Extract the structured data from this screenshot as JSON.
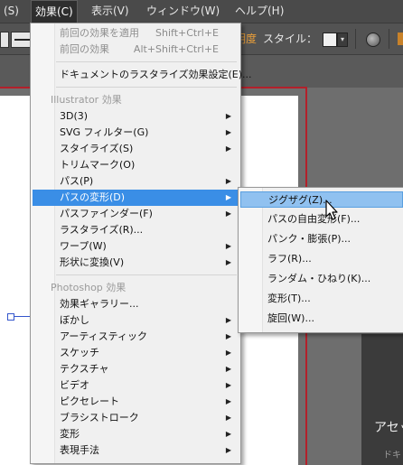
{
  "menubar": {
    "items": [
      {
        "label": "(S)",
        "active": false
      },
      {
        "label": "効果(C)",
        "active": true
      },
      {
        "label": "表示(V)",
        "active": false
      },
      {
        "label": "ウィンドウ(W)",
        "active": false
      },
      {
        "label": "ヘルプ(H)",
        "active": false
      }
    ]
  },
  "controlbar": {
    "opacity_label": "明度",
    "style_label": "スタイル："
  },
  "effect_menu": {
    "apply_last": {
      "label": "前回の効果を適用",
      "shortcut": "Shift+Ctrl+E"
    },
    "last_effect": {
      "label": "前回の効果",
      "shortcut": "Alt+Shift+Ctrl+E"
    },
    "raster_settings": "ドキュメントのラスタライズ効果設定(E)...",
    "illustrator_header": "Illustrator 効果",
    "illustrator_items": [
      {
        "label": "3D(3)",
        "submenu": true
      },
      {
        "label": "SVG フィルター(G)",
        "submenu": true
      },
      {
        "label": "スタイライズ(S)",
        "submenu": true
      },
      {
        "label": "トリムマーク(O)",
        "submenu": false
      },
      {
        "label": "パス(P)",
        "submenu": true
      },
      {
        "label": "パスの変形(D)",
        "submenu": true
      },
      {
        "label": "パスファインダー(F)",
        "submenu": true
      },
      {
        "label": "ラスタライズ(R)...",
        "submenu": false
      },
      {
        "label": "ワープ(W)",
        "submenu": true
      },
      {
        "label": "形状に変換(V)",
        "submenu": true
      }
    ],
    "photoshop_header": "Photoshop 効果",
    "photoshop_items": [
      {
        "label": "効果ギャラリー...",
        "submenu": false
      },
      {
        "label": "ぼかし",
        "submenu": true
      },
      {
        "label": "アーティスティック",
        "submenu": true
      },
      {
        "label": "スケッチ",
        "submenu": true
      },
      {
        "label": "テクスチャ",
        "submenu": true
      },
      {
        "label": "ビデオ",
        "submenu": true
      },
      {
        "label": "ピクセレート",
        "submenu": true
      },
      {
        "label": "ブラシストローク",
        "submenu": true
      },
      {
        "label": "変形",
        "submenu": true
      },
      {
        "label": "表現手法",
        "submenu": true
      }
    ]
  },
  "distort_submenu": {
    "items": [
      "ジグザグ(Z)...",
      "パスの自由変形(F)...",
      "パンク・膨張(P)...",
      "ラフ(R)...",
      "ランダム・ひねり(K)...",
      "変形(T)...",
      "旋回(W)..."
    ]
  },
  "panel": {
    "title": "アセッ",
    "subtitle": "ドキ"
  },
  "colors": {
    "highlight": "#3a8ee6",
    "submenu_highlight": "#90c1f0",
    "artboard_border": "#b3202a",
    "accent_orange": "#e89e3a"
  }
}
